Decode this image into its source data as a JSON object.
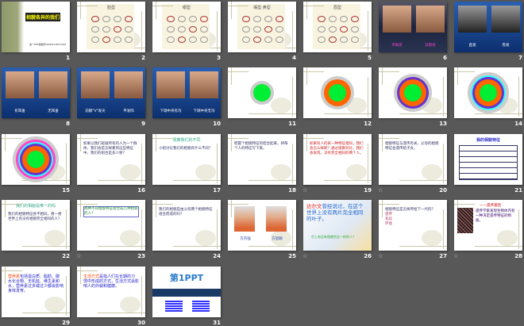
{
  "view": "slide-sorter",
  "slides": [
    {
      "n": "1",
      "kind": "title",
      "title": "相貌各异的我们",
      "sub": "第一PPT模板网 WWW.1PPT.COM"
    },
    {
      "n": "2",
      "kind": "sketch",
      "title": "脸型"
    },
    {
      "n": "3",
      "kind": "sketch",
      "title": "眼型"
    },
    {
      "n": "4",
      "kind": "sketch",
      "title": "嘴型 鼻型"
    },
    {
      "n": "5",
      "kind": "sketch",
      "title": "眉型"
    },
    {
      "n": "6",
      "kind": "dark",
      "labels": [
        "单眼皮",
        "双眼皮"
      ]
    },
    {
      "n": "7",
      "kind": "blue",
      "labels": [
        "直发",
        "卷发"
      ]
    },
    {
      "n": "8",
      "kind": "blue",
      "labels": [
        "有耳垂",
        "无耳垂"
      ]
    },
    {
      "n": "9",
      "kind": "blue",
      "labels": [
        "前额\"V\"发尖",
        "平发际"
      ]
    },
    {
      "n": "10",
      "kind": "blue",
      "labels": [
        "下颌中央有沟",
        "下颌中央无沟"
      ]
    },
    {
      "n": "11",
      "kind": "circle",
      "rings": 1
    },
    {
      "n": "12",
      "kind": "circle",
      "rings": 2
    },
    {
      "n": "13",
      "kind": "circle",
      "rings": 3
    },
    {
      "n": "14",
      "kind": "circle",
      "rings": 4
    },
    {
      "n": "15",
      "kind": "circle",
      "rings": 5
    },
    {
      "n": "16",
      "kind": "text",
      "body": "如果以我们班级所有的人为一个群体，我们会是怎样看到这些特征中，我们的组合是多少呢？"
    },
    {
      "n": "17",
      "kind": "text",
      "title": "观察我们的不同",
      "body": "小组讨论我们的相貌有什么不同？"
    },
    {
      "n": "18",
      "kind": "text",
      "body": "把握个相貌特征的结合起来，将每个人的特征写下来。"
    },
    {
      "n": "19",
      "kind": "text",
      "star": true,
      "body": "如果有人的某一种特征相同，我们会怎么样呢？通过观察对比，我们会发现，没有完全相同的两个人。"
    },
    {
      "n": "20",
      "kind": "text",
      "star": true,
      "body": "相貌特征与遗传有关，父母的相貌特征会遗传给子女。"
    },
    {
      "n": "21",
      "kind": "table",
      "title": "我的相貌特征"
    },
    {
      "n": "22",
      "kind": "text",
      "title": "我们的相貌是唯一的吗",
      "body": "我们的相貌特征各不相同，想一想世界上有没有相貌完全相同的人？"
    },
    {
      "n": "23",
      "kind": "text",
      "star": true,
      "body": "两种不同相貌特征组合成几种相貌的人？"
    },
    {
      "n": "24",
      "kind": "text",
      "body": "我们的相貌是由父母两个相貌特征组合而成的吗？"
    },
    {
      "n": "25",
      "kind": "photo2",
      "labels": [
        "方舟强",
        "方思颖"
      ]
    },
    {
      "n": "26",
      "kind": "quote",
      "star": true,
      "hl": "达尔文",
      "body": "曾经说过，在这个世界上没有两片完全相同的叶子。",
      "sub": "世上有没有相貌完全一样的人？"
    },
    {
      "n": "27",
      "kind": "text",
      "star": true,
      "body": "相貌特征是怎样传给下一代的？",
      "items": [
        "遗传",
        "变异",
        "环境"
      ]
    },
    {
      "n": "28",
      "kind": "dna",
      "star": true,
      "title": "——遗传基因",
      "body": "遗传学家发现生物体内有一种决定遗传特征的物质。"
    },
    {
      "n": "29",
      "kind": "text",
      "hl": "营养素",
      "body": "包括蛋白质、脂肪、碳水化合物、无机盐、维生素和水，营养素过多或过少都会影响身体发育。"
    },
    {
      "n": "30",
      "kind": "text",
      "hl": "生活方式",
      "body": "是指人们在长期的习惯中形成的方式，生活方式会影响人的外貌和健康。"
    },
    {
      "n": "31",
      "kind": "brand",
      "title": "第1PPT"
    }
  ],
  "colors": {
    "background": "#585858",
    "accent_blue": "#1a4a9c"
  }
}
